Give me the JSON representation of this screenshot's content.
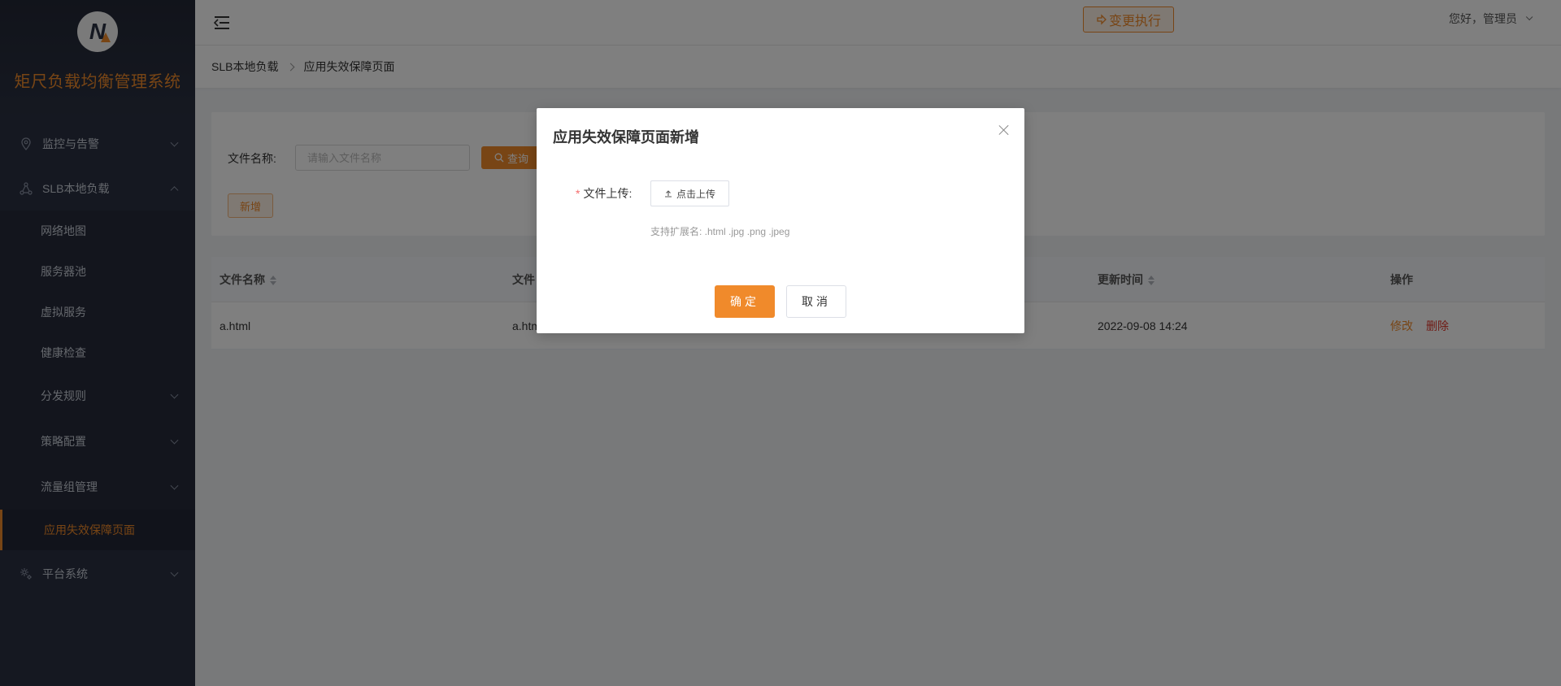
{
  "brand": {
    "title": "矩尺负载均衡管理系统",
    "logo_letter": "N"
  },
  "sidebar": {
    "items": [
      {
        "label": "监控与告警",
        "icon": "location-pin-icon",
        "expanded": false
      },
      {
        "label": "SLB本地负载",
        "icon": "network-nodes-icon",
        "expanded": true,
        "children": [
          {
            "label": "网络地图"
          },
          {
            "label": "服务器池"
          },
          {
            "label": "虚拟服务"
          },
          {
            "label": "健康检查"
          },
          {
            "label": "分发规则",
            "has_children": true
          },
          {
            "label": "策略配置",
            "has_children": true
          },
          {
            "label": "流量组管理",
            "has_children": true
          },
          {
            "label": "应用失效保障页面",
            "active": true
          }
        ]
      },
      {
        "label": "平台系统",
        "icon": "gear-icon",
        "expanded": false
      }
    ]
  },
  "header": {
    "exec_button": "变更执行",
    "greeting": "您好，管理员"
  },
  "breadcrumb": [
    "SLB本地负载",
    "应用失效保障页面"
  ],
  "search": {
    "label": "文件名称:",
    "placeholder": "请输入文件名称",
    "query_button": "查询",
    "add_button": "新增"
  },
  "table": {
    "columns": [
      "文件名称",
      "文件",
      "更新时间",
      "操作"
    ],
    "rows": [
      {
        "name": "a.html",
        "file": "a.htm",
        "updated": "2022-09-08 14:24",
        "edit": "修改",
        "delete": "删除"
      }
    ]
  },
  "modal": {
    "title": "应用失效保障页面新增",
    "field_label": "文件上传:",
    "required_mark": "*",
    "upload_button": "点击上传",
    "hint": "支持扩展名: .html .jpg .png .jpeg",
    "confirm": "确定",
    "cancel": "取消"
  },
  "colors": {
    "accent": "#f08a2b",
    "sidebar_bg": "#2a3042",
    "danger": "#e0362b"
  }
}
